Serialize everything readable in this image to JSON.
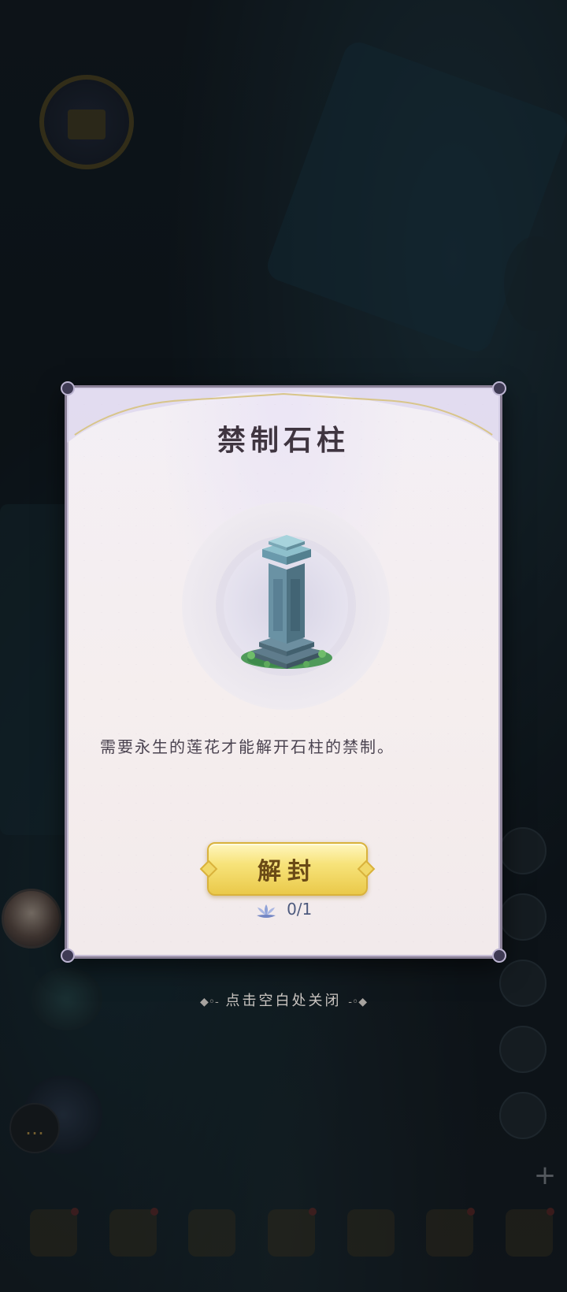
{
  "modal": {
    "title": "禁制石柱",
    "item_icon": "stone-pillar",
    "description": "需要永生的莲花才能解开石柱的禁制。",
    "unseal_label": "解封",
    "cost_icon": "lotus-icon",
    "cost_text": "0/1"
  },
  "close_hint": {
    "text": "点击空白处关闭",
    "left_deco": "◆◦-",
    "right_deco": "-◦◆"
  },
  "colors": {
    "accent_gold": "#f0d25a",
    "title_text": "#3f3540",
    "cost_blue": "#4d5a7e"
  }
}
